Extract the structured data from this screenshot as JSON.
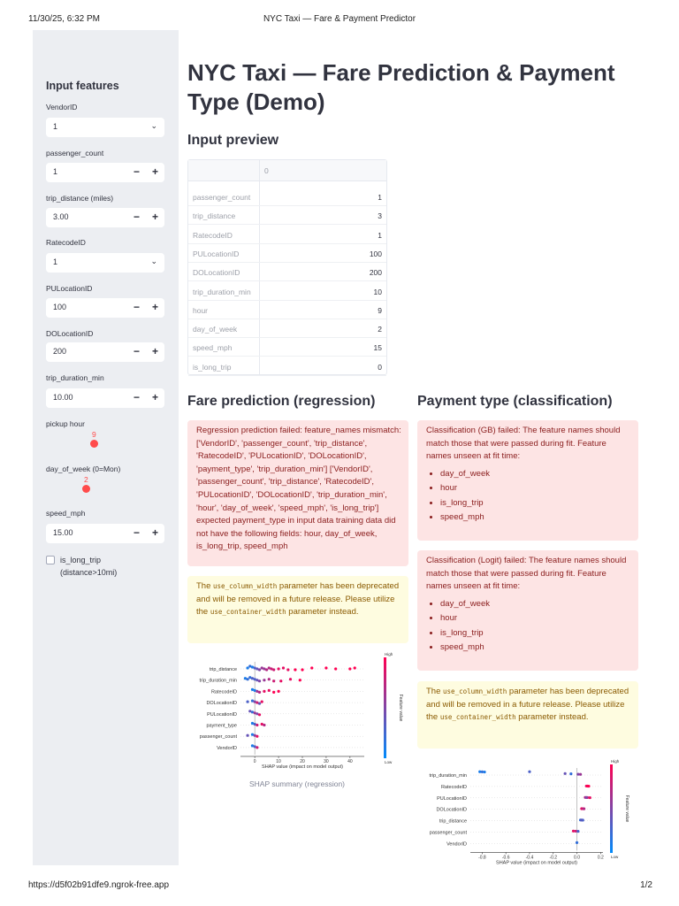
{
  "print_header": {
    "datetime": "11/30/25, 6:32 PM",
    "title": "NYC Taxi — Fare & Payment Predictor"
  },
  "print_footer": {
    "url": "https://d5f02b91dfe9.ngrok-free.app",
    "page": "1/2"
  },
  "sidebar": {
    "title": "Input features",
    "vendor": {
      "label": "VendorID",
      "value": "1"
    },
    "passenger": {
      "label": "passenger_count",
      "value": "1"
    },
    "trip_distance": {
      "label": "trip_distance (miles)",
      "value": "3.00"
    },
    "ratecode": {
      "label": "RatecodeID",
      "value": "1"
    },
    "pu_location": {
      "label": "PULocationID",
      "value": "100"
    },
    "do_location": {
      "label": "DOLocationID",
      "value": "200"
    },
    "duration": {
      "label": "trip_duration_min",
      "value": "10.00"
    },
    "pickup_hour": {
      "label": "pickup hour",
      "value": "9",
      "min": 0,
      "max": 23
    },
    "day_of_week": {
      "label": "day_of_week (0=Mon)",
      "value": "2",
      "min": 0,
      "max": 6
    },
    "speed": {
      "label": "speed_mph",
      "value": "15.00"
    },
    "is_long_trip": {
      "label": "is_long_trip (distance>10mi)",
      "checked": false
    },
    "icons": {
      "minus": "−",
      "plus": "+",
      "chevron": "⌄"
    }
  },
  "main": {
    "title": "NYC Taxi — Fare Prediction & Payment Type (Demo)",
    "input_preview": {
      "heading": "Input preview",
      "column": "0",
      "rows": [
        {
          "k": "passenger_count",
          "v": "1"
        },
        {
          "k": "trip_distance",
          "v": "3"
        },
        {
          "k": "RatecodeID",
          "v": "1"
        },
        {
          "k": "PULocationID",
          "v": "100"
        },
        {
          "k": "DOLocationID",
          "v": "200"
        },
        {
          "k": "trip_duration_min",
          "v": "10"
        },
        {
          "k": "hour",
          "v": "9"
        },
        {
          "k": "day_of_week",
          "v": "2"
        },
        {
          "k": "speed_mph",
          "v": "15"
        },
        {
          "k": "is_long_trip",
          "v": "0"
        }
      ]
    },
    "fare": {
      "heading": "Fare prediction (regression)",
      "error": "Regression prediction failed: feature_names mismatch: ['VendorID', 'passenger_count', 'trip_distance', 'RatecodeID', 'PULocationID', 'DOLocationID', 'payment_type', 'trip_duration_min'] ['VendorID', 'passenger_count', 'trip_distance', 'RatecodeID', 'PULocationID', 'DOLocationID', 'trip_duration_min', 'hour', 'day_of_week', 'speed_mph', 'is_long_trip'] expected payment_type in input data training data did not have the following fields: hour, day_of_week, is_long_trip, speed_mph",
      "warning": {
        "pre": "The ",
        "code1": "use_column_width",
        "mid": " parameter has been deprecated and will be removed in a future release. Please utilize the ",
        "code2": "use_container_width",
        "post": " parameter instead."
      },
      "shap_caption": "SHAP summary (regression)"
    },
    "payment": {
      "heading": "Payment type (classification)",
      "error_gb": "Classification (GB) failed: The feature names should match those that were passed during fit. Feature names unseen at fit time:",
      "error_gb_items": [
        "day_of_week",
        "hour",
        "is_long_trip",
        "speed_mph"
      ],
      "error_logit": "Classification (Logit) failed: The feature names should match those that were passed during fit. Feature names unseen at fit time:",
      "error_logit_items": [
        "day_of_week",
        "hour",
        "is_long_trip",
        "speed_mph"
      ],
      "warning": {
        "pre": "The ",
        "code1": "use_column_width",
        "mid": " parameter has been deprecated and will be removed in a future release. Please utilize the ",
        "code2": "use_container_width",
        "post": " parameter instead."
      }
    }
  },
  "chart_data": [
    {
      "type": "scatter",
      "features": [
        "trip_distance",
        "trip_duration_min",
        "RatecodeID",
        "DOLocationID",
        "PULocationID",
        "payment_type",
        "passenger_count",
        "VendorID"
      ],
      "xlabel": "SHAP value (impact on model output)",
      "xticks": [
        0,
        10,
        20,
        30,
        40
      ],
      "xlim": [
        -6,
        46
      ],
      "colorbar_label": "Feature value",
      "colorbar_high": "High",
      "colorbar_low": "Low",
      "points": [
        [
          -3,
          0,
          0.1
        ],
        [
          -2,
          0,
          0.2
        ],
        [
          -1,
          0,
          0.1
        ],
        [
          0,
          0,
          0.3
        ],
        [
          1,
          0,
          0.4
        ],
        [
          2,
          0,
          0.5
        ],
        [
          3,
          0,
          0.6
        ],
        [
          4,
          0,
          0.6
        ],
        [
          5,
          0,
          0.7
        ],
        [
          6,
          0,
          0.7
        ],
        [
          7,
          0,
          0.8
        ],
        [
          8,
          0,
          0.8
        ],
        [
          10,
          0,
          0.9
        ],
        [
          12,
          0,
          0.9
        ],
        [
          14,
          0,
          0.9
        ],
        [
          17,
          0,
          1
        ],
        [
          20,
          0,
          1
        ],
        [
          24,
          0,
          1
        ],
        [
          30,
          0,
          1
        ],
        [
          34,
          0,
          1
        ],
        [
          40,
          0,
          1
        ],
        [
          42,
          0,
          1
        ],
        [
          -4,
          1,
          0.1
        ],
        [
          -3,
          1,
          0.2
        ],
        [
          -2,
          1,
          0.2
        ],
        [
          -1,
          1,
          0.3
        ],
        [
          0,
          1,
          0.3
        ],
        [
          1,
          1,
          0.4
        ],
        [
          2,
          1,
          0.5
        ],
        [
          4,
          1,
          0.6
        ],
        [
          6,
          1,
          0.7
        ],
        [
          8,
          1,
          0.8
        ],
        [
          11,
          1,
          0.9
        ],
        [
          15,
          1,
          0.9
        ],
        [
          19,
          1,
          1
        ],
        [
          -1,
          2,
          0.1
        ],
        [
          0,
          2,
          0.1
        ],
        [
          1,
          2,
          0.6
        ],
        [
          2,
          2,
          0.7
        ],
        [
          4,
          2,
          0.9
        ],
        [
          6,
          2,
          0.9
        ],
        [
          8,
          2,
          1
        ],
        [
          10,
          2,
          1
        ],
        [
          -3,
          3,
          0.3
        ],
        [
          -1,
          3,
          0.2
        ],
        [
          0,
          3,
          0.5
        ],
        [
          1,
          3,
          0.8
        ],
        [
          2,
          3,
          0.4
        ],
        [
          3,
          3,
          0.9
        ],
        [
          -2,
          4,
          0.4
        ],
        [
          -1,
          4,
          0.2
        ],
        [
          0,
          4,
          0.6
        ],
        [
          1,
          4,
          0.5
        ],
        [
          2,
          4,
          0.9
        ],
        [
          -1,
          5,
          0.1
        ],
        [
          0,
          5,
          0.3
        ],
        [
          1,
          5,
          0.8
        ],
        [
          3,
          5,
          0.9
        ],
        [
          4,
          5,
          0.7
        ],
        [
          -3,
          6,
          0.4
        ],
        [
          -1,
          6,
          0.1
        ],
        [
          0,
          6,
          0.5
        ],
        [
          1,
          6,
          0.9
        ],
        [
          -1,
          7,
          0.1
        ],
        [
          0,
          7,
          0.3
        ],
        [
          1,
          7,
          0.8
        ]
      ]
    },
    {
      "type": "scatter",
      "features": [
        "trip_duration_min",
        "RatecodeID",
        "PULocationID",
        "DOLocationID",
        "trip_distance",
        "passenger_count",
        "VendorID"
      ],
      "xlabel": "SHAP value (impact on model output)",
      "xticks": [
        -0.8,
        -0.6,
        -0.4,
        -0.2,
        0.0,
        0.2
      ],
      "xlim": [
        -0.9,
        0.22
      ],
      "colorbar_label": "Feature value",
      "colorbar_high": "High",
      "colorbar_low": "Low",
      "points": [
        [
          -0.82,
          0,
          0.1
        ],
        [
          -0.8,
          0,
          0.2
        ],
        [
          -0.78,
          0,
          0.1
        ],
        [
          -0.4,
          0,
          0.3
        ],
        [
          -0.1,
          0,
          0.4
        ],
        [
          -0.05,
          0,
          0.2
        ],
        [
          0.01,
          0,
          0.5
        ],
        [
          0.03,
          0,
          0.6
        ],
        [
          0.08,
          1,
          0.9
        ],
        [
          0.1,
          1,
          1
        ],
        [
          0.09,
          1,
          1
        ],
        [
          0.07,
          2,
          0.7
        ],
        [
          0.09,
          2,
          0.8
        ],
        [
          0.11,
          2,
          0.9
        ],
        [
          0.08,
          2,
          0.5
        ],
        [
          0.04,
          3,
          0.9
        ],
        [
          0.05,
          3,
          0.8
        ],
        [
          0.06,
          3,
          0.7
        ],
        [
          0.03,
          4,
          0.2
        ],
        [
          0.04,
          4,
          0.4
        ],
        [
          0.05,
          4,
          0.3
        ],
        [
          -0.03,
          5,
          0.9
        ],
        [
          -0.01,
          5,
          0.8
        ],
        [
          0.01,
          5,
          0.3
        ],
        [
          0.0,
          6,
          0.2
        ]
      ]
    }
  ]
}
